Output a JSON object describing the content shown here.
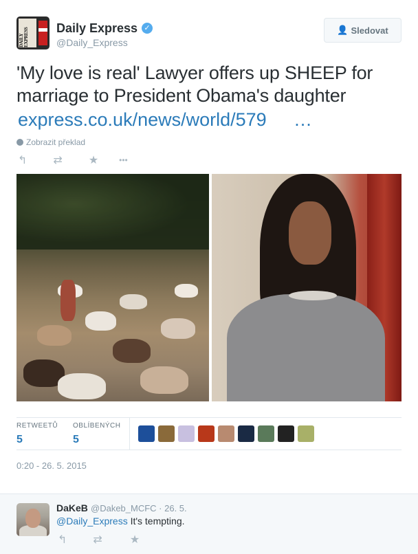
{
  "tweet": {
    "author": {
      "name": "Daily Express",
      "handle": "@Daily_Express",
      "avatar_text": "DAILY EXPRESS",
      "verified_glyph": "✓"
    },
    "follow_button": {
      "icon": "👤",
      "label": "Sledovat"
    },
    "text": "'My love is real' Lawyer offers up SHEEP for marriage to President Obama's daughter",
    "link": "express.co.uk/news/world/579",
    "link_ellipsis": "…",
    "translate_label": "Zobrazit překlad",
    "actions": {
      "reply_icon": "↰",
      "retweet_icon": "⇄",
      "favorite_icon": "★",
      "more_icon": "•••"
    },
    "stats": {
      "retweets_label": "RETWEETŮ",
      "retweets_value": "5",
      "favorites_label": "OBLÍBENÝCH",
      "favorites_value": "5"
    },
    "favoriters": [
      {
        "color": "#1d4f9a"
      },
      {
        "color": "#8a6a3a"
      },
      {
        "color": "#c8c0e0"
      },
      {
        "color": "#b8381a"
      },
      {
        "color": "#b88a70"
      },
      {
        "color": "#1a2a44"
      },
      {
        "color": "#5a7a5a"
      },
      {
        "color": "#222222"
      },
      {
        "color": "#a8b068"
      }
    ],
    "timestamp": "0:20 - 26. 5. 2015"
  },
  "reply": {
    "name": "DaKeB",
    "handle": "@Dakeb_MCFC · 26. 5.",
    "mention": "@Daily_Express",
    "text": " It's tempting."
  }
}
